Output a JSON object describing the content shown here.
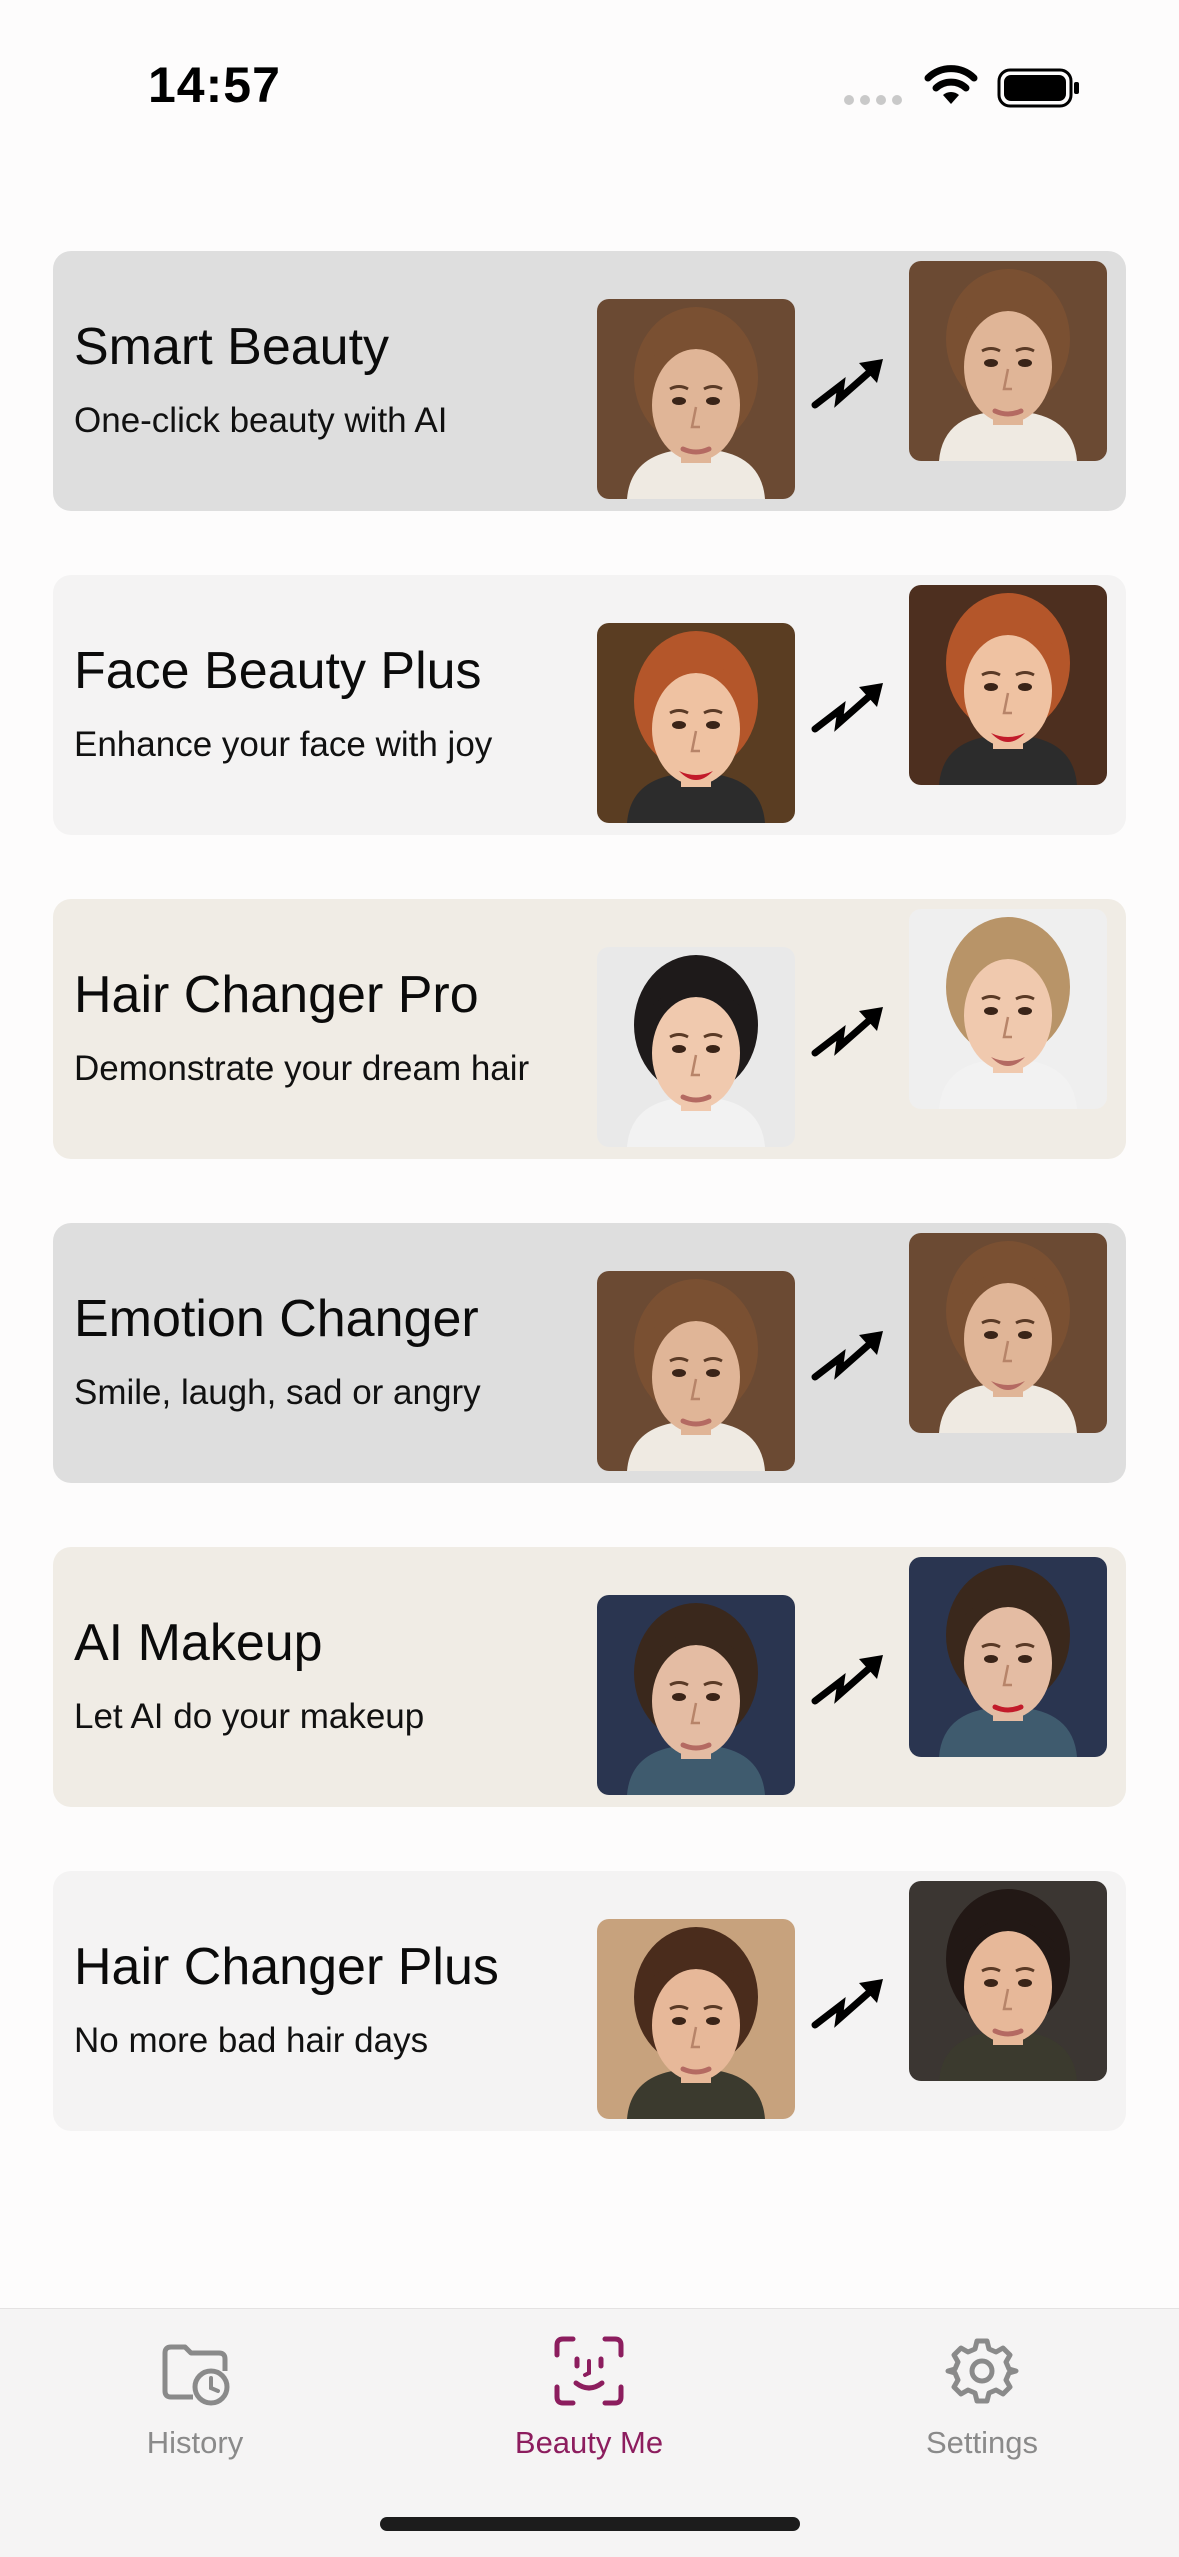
{
  "status_bar": {
    "time": "14:57"
  },
  "colors": {
    "accent": "#8c1d5e",
    "tab_inactive": "#8a8a8a"
  },
  "cards": [
    {
      "title": "Smart Beauty",
      "subtitle": "One-click beauty with AI",
      "background": "#dedede",
      "before_icon": "woman-bangs-portrait",
      "after_icon": "woman-bangs-portrait-smoothed"
    },
    {
      "title": "Face Beauty Plus",
      "subtitle": "Enhance your face with joy",
      "background": "#f4f3f3",
      "before_icon": "redhead-smiling-portrait",
      "after_icon": "redhead-smiling-portrait-enhanced"
    },
    {
      "title": "Hair Changer Pro",
      "subtitle": "Demonstrate your dream hair",
      "background": "#f0ece5",
      "before_icon": "dark-bun-hair-portrait",
      "after_icon": "blonde-braid-hair-portrait"
    },
    {
      "title": "Emotion Changer",
      "subtitle": "Smile, laugh, sad or angry",
      "background": "#dedede",
      "before_icon": "woman-bangs-neutral-portrait",
      "after_icon": "woman-bangs-smiling-portrait"
    },
    {
      "title": "AI Makeup",
      "subtitle": "Let AI do your makeup",
      "background": "#f0ece5",
      "before_icon": "brunette-plain-portrait",
      "after_icon": "brunette-makeup-portrait"
    },
    {
      "title": "Hair Changer Plus",
      "subtitle": "No more bad hair days",
      "background": "#f4f3f3",
      "before_icon": "updo-hair-portrait",
      "after_icon": "long-dark-hair-portrait"
    }
  ],
  "tabs": [
    {
      "label": "History",
      "icon": "folder-clock-icon",
      "active": false
    },
    {
      "label": "Beauty Me",
      "icon": "face-scan-icon",
      "active": true
    },
    {
      "label": "Settings",
      "icon": "gear-icon",
      "active": false
    }
  ]
}
